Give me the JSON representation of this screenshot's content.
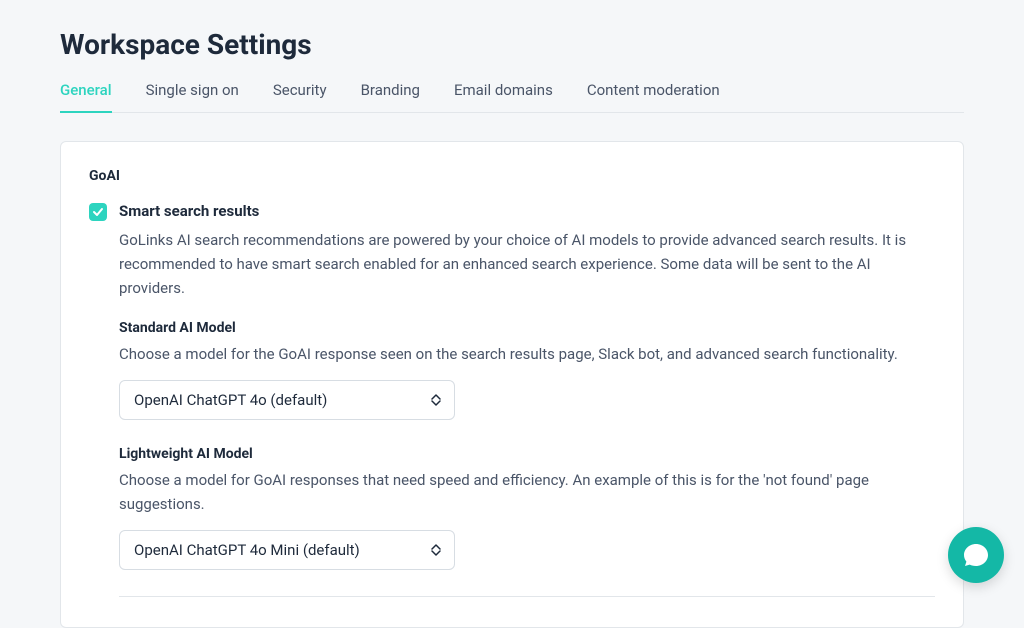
{
  "page": {
    "title": "Workspace Settings"
  },
  "tabs": [
    {
      "label": "General",
      "active": true
    },
    {
      "label": "Single sign on",
      "active": false
    },
    {
      "label": "Security",
      "active": false
    },
    {
      "label": "Branding",
      "active": false
    },
    {
      "label": "Email domains",
      "active": false
    },
    {
      "label": "Content moderation",
      "active": false
    }
  ],
  "section": {
    "heading": "GoAI",
    "smart_search": {
      "checked": true,
      "label": "Smart search results",
      "description": "GoLinks AI search recommendations are powered by your choice of AI models to provide advanced search results. It is recommended to have smart search enabled for an enhanced search experience. Some data will be sent to the AI providers."
    },
    "standard_model": {
      "label": "Standard AI Model",
      "description": "Choose a model for the GoAI response seen on the search results page, Slack bot, and advanced search functionality.",
      "selected": "OpenAI ChatGPT 4o (default)"
    },
    "lightweight_model": {
      "label": "Lightweight AI Model",
      "description": "Choose a model for GoAI responses that need speed and efficiency. An example of this is for the 'not found' page suggestions.",
      "selected": "OpenAI ChatGPT 4o Mini (default)"
    }
  }
}
